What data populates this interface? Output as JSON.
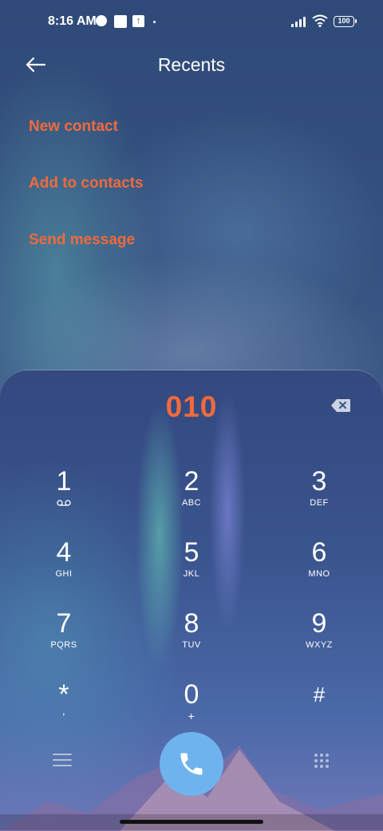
{
  "status_bar": {
    "time": "8:16 AM",
    "battery": "100"
  },
  "header": {
    "title": "Recents",
    "back_icon": "arrow-left-icon"
  },
  "actions": {
    "new_contact": "New contact",
    "add_to_contacts": "Add to contacts",
    "send_message": "Send message"
  },
  "dialer": {
    "number": "010",
    "keys": [
      {
        "digit": "1",
        "letters": ""
      },
      {
        "digit": "2",
        "letters": "ABC"
      },
      {
        "digit": "3",
        "letters": "DEF"
      },
      {
        "digit": "4",
        "letters": "GHI"
      },
      {
        "digit": "5",
        "letters": "JKL"
      },
      {
        "digit": "6",
        "letters": "MNO"
      },
      {
        "digit": "7",
        "letters": "PQRS"
      },
      {
        "digit": "8",
        "letters": "TUV"
      },
      {
        "digit": "9",
        "letters": "WXYZ"
      },
      {
        "digit": "*",
        "letters": ","
      },
      {
        "digit": "0",
        "letters": "+"
      },
      {
        "digit": "#",
        "letters": ""
      }
    ]
  },
  "colors": {
    "accent": "#f26a3c",
    "call_button": "#6fb3ee"
  }
}
